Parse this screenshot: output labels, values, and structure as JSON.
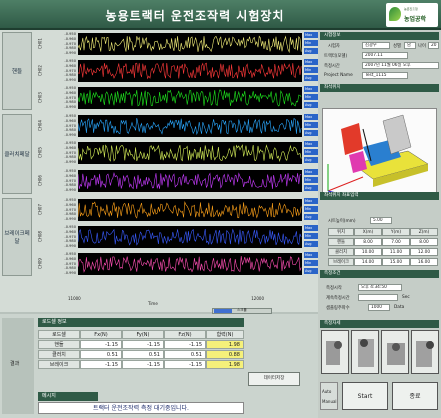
{
  "title": "농용트랙터 운전조작력 시험장치",
  "logo": {
    "line1": "농촌진흥청",
    "line2": "농업공학"
  },
  "groups": [
    "핸들",
    "클러치페달",
    "브레이크페달"
  ],
  "strips": [
    {
      "name": "CH01",
      "ticks": [
        "-0.950",
        "-0.960",
        "-0.970",
        "-0.980",
        "-0.990"
      ],
      "side": [
        "Max",
        "Min",
        "Avg"
      ],
      "vals": [
        "-0.405",
        "-1.499",
        "-0.901"
      ],
      "color": "#f5f07a"
    },
    {
      "name": "CH02",
      "ticks": [
        "-0.950",
        "-0.960",
        "-0.970",
        "-0.980",
        "-0.990"
      ],
      "side": [
        "Max",
        "Min",
        "Avg"
      ],
      "vals": [
        "-0.405",
        "-1.499",
        "-0.901"
      ],
      "color": "#ff3a3a"
    },
    {
      "name": "CH03",
      "ticks": [
        "-0.950",
        "-0.960",
        "-0.970",
        "-0.980",
        "-0.990"
      ],
      "side": [
        "Max",
        "Min",
        "Avg"
      ],
      "vals": [
        "-0.405",
        "-1.499",
        "-0.901"
      ],
      "color": "#1ee61e"
    },
    {
      "name": "CH04",
      "ticks": [
        "-0.950",
        "-0.960",
        "-0.970",
        "-0.980",
        "-0.990"
      ],
      "side": [
        "Max",
        "Min",
        "Avg"
      ],
      "vals": [
        "-0.405",
        "-1.499",
        "-0.901"
      ],
      "color": "#2aa8ff"
    },
    {
      "name": "CH05",
      "ticks": [
        "-0.950",
        "-0.960",
        "-0.970",
        "-0.980",
        "-0.990"
      ],
      "side": [
        "Max",
        "Min",
        "Avg"
      ],
      "vals": [
        "-0.405",
        "-1.499",
        "-0.901"
      ],
      "color": "#d7f05a"
    },
    {
      "name": "CH06",
      "ticks": [
        "-0.950",
        "-0.960",
        "-0.970",
        "-0.980",
        "-0.990"
      ],
      "side": [
        "Max",
        "Min",
        "Avg"
      ],
      "vals": [
        "-0.405",
        "-1.499",
        "-0.901"
      ],
      "color": "#c73cff"
    },
    {
      "name": "CH07",
      "ticks": [
        "-0.950",
        "-0.960",
        "-0.970",
        "-0.980",
        "-0.990"
      ],
      "side": [
        "Max",
        "Min",
        "Avg"
      ],
      "vals": [
        "-0.405",
        "-1.499",
        "-0.901"
      ],
      "color": "#ffa21a"
    },
    {
      "name": "CH08",
      "ticks": [
        "-0.950",
        "-0.960",
        "-0.970",
        "-0.980",
        "-0.990"
      ],
      "side": [
        "Max",
        "Min",
        "Avg"
      ],
      "vals": [
        "-0.405",
        "-1.499",
        "-0.901"
      ],
      "color": "#3a5cff"
    },
    {
      "name": "CH09",
      "ticks": [
        "-0.950",
        "-0.960",
        "-0.970",
        "-0.980",
        "-0.990"
      ],
      "side": [
        "Max",
        "Min",
        "Avg"
      ],
      "vals": [
        "-0.405",
        "-1.499",
        "-0.901"
      ],
      "color": "#ff4fb4"
    }
  ],
  "xaxis": {
    "start": "11000",
    "end": "12000",
    "label": "Time"
  },
  "scroll_label": "스크롤",
  "load": {
    "section": "로드셀 정보",
    "tag": "결과",
    "headers": [
      "로드셀",
      "Fx(N)",
      "Fy(N)",
      "Fz(N)",
      "합력(N)"
    ],
    "rows": [
      {
        "name": "핸들",
        "fx": "-1.15",
        "fy": "-1.15",
        "fz": "-1.15",
        "total": "1.98"
      },
      {
        "name": "클러치",
        "fx": "0.51",
        "fy": "0.51",
        "fz": "0.51",
        "total": "0.88"
      },
      {
        "name": "브레이크",
        "fx": "-1.15",
        "fy": "-1.15",
        "fz": "-1.15",
        "total": "1.98"
      }
    ],
    "save_button": "데이터저장",
    "msg_section": "메시지",
    "message": "트랙터 운전조작력 측정 대기중입니다."
  },
  "right": {
    "info_section": "시험정보",
    "tester_label": "시험자",
    "tester": "김광우",
    "sex_label": "성별",
    "sex": "남",
    "age_label": "나이",
    "age": "20",
    "model_label": "트랙터(모델)",
    "model": "2007.11",
    "date_label": "측정시간",
    "date": "2007년 11월 06일 오후",
    "project_label": "Project Name",
    "project": "Test_1115",
    "pos_section": "좌석위치",
    "coord_section": "좌석위치 좌표입력",
    "seatheight_label": "시트높이(mm)",
    "seatheight": "5.00",
    "grid_headers": [
      "위치",
      "X(m)",
      "Y(m)",
      "Z(m)"
    ],
    "grid_rows": [
      {
        "name": "핸들",
        "x": "8.00",
        "y": "7.00",
        "z": "8.00"
      },
      {
        "name": "클러치",
        "x": "10.00",
        "y": "11.00",
        "z": "12.00"
      },
      {
        "name": "브레이크",
        "x": "14.00",
        "y": "15.00",
        "z": "16.00"
      }
    ],
    "time_section": "측정조건",
    "start_label": "측정시작",
    "start_value": "오후 4:34:50",
    "elapsed_label": "계속측정시간",
    "elapsed_unit": "Sec",
    "rate_label": "샘플링주파수",
    "rate_value": "1000",
    "rate_unit": "Data",
    "photo_section": "측정자세",
    "mode_auto": "Auto",
    "mode_manual": "Manual",
    "start_button": "Start",
    "stop_button": "종료"
  }
}
